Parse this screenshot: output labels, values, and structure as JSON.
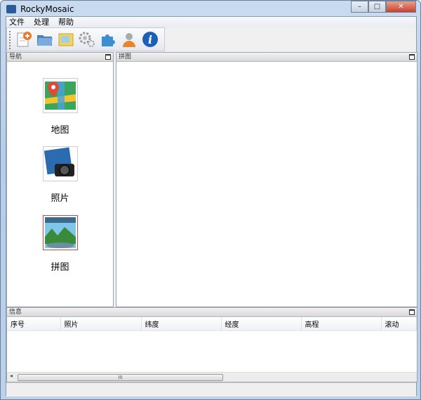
{
  "window": {
    "title": "RockyMosaic",
    "controls": {
      "minimize": "–",
      "maximize": "□",
      "close": "✕"
    }
  },
  "menu": [
    "文件",
    "处理",
    "帮助"
  ],
  "toolbar": [
    "new-project-icon",
    "open-folder-icon",
    "import-icon",
    "settings-icon",
    "plugin-icon",
    "user-icon",
    "info-icon"
  ],
  "nav_panel": {
    "title": "导航",
    "items": [
      {
        "label": "地图",
        "icon": "map-icon"
      },
      {
        "label": "照片",
        "icon": "camera-icon"
      },
      {
        "label": "拼图",
        "icon": "mosaic-icon"
      }
    ]
  },
  "mosaic_panel": {
    "title": "拼图"
  },
  "info_panel": {
    "title": "信息",
    "columns": [
      "序号",
      "照片",
      "纬度",
      "经度",
      "高程",
      "滚动"
    ],
    "scroll_thumb": "III"
  }
}
